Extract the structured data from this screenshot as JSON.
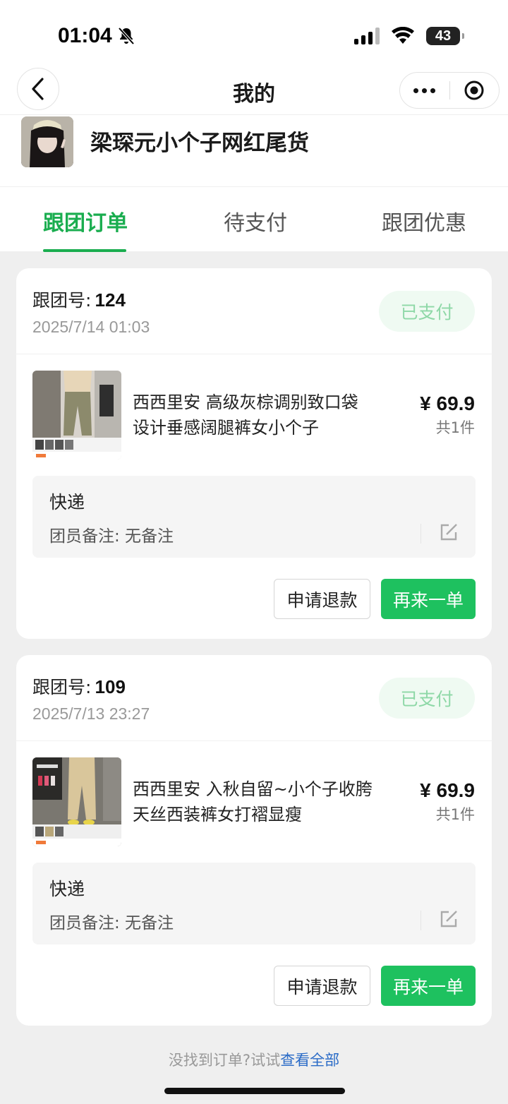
{
  "status_bar": {
    "time": "01:04",
    "battery": "43"
  },
  "nav": {
    "title": "我的"
  },
  "profile": {
    "name": "梁琛元小个子网红尾货"
  },
  "tabs": [
    {
      "label": "跟团订单",
      "active": true
    },
    {
      "label": "待支付",
      "active": false
    },
    {
      "label": "跟团优惠",
      "active": false
    }
  ],
  "orders": [
    {
      "no_label": "跟团号:",
      "no": "124",
      "time": "2025/7/14 01:03",
      "status": "已支付",
      "title": "西西里安 高级灰棕调别致口袋设计垂感阔腿裤女小个子",
      "price": "¥ 69.9",
      "qty": "共1件",
      "delivery": "快递",
      "remark": "团员备注: 无备注",
      "refund_label": "申请退款",
      "reorder_label": "再来一单"
    },
    {
      "no_label": "跟团号:",
      "no": "109",
      "time": "2025/7/13 23:27",
      "status": "已支付",
      "title": "西西里安 入秋自留~小个子收胯天丝西装裤女打褶显瘦",
      "price": "¥ 69.9",
      "qty": "共1件",
      "delivery": "快递",
      "remark": "团员备注: 无备注",
      "refund_label": "申请退款",
      "reorder_label": "再来一单"
    }
  ],
  "footer": {
    "hint": "没找到订单?试试",
    "link": "查看全部"
  },
  "colors": {
    "accent": "#1aad4f",
    "button_green": "#1ec15f",
    "paid_text": "#8ed8a7",
    "link": "#2a6bc7"
  }
}
